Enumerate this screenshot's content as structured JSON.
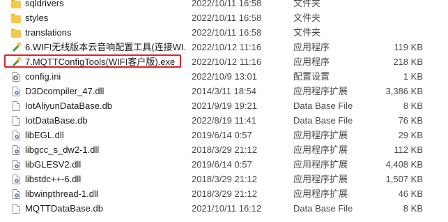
{
  "files": [
    {
      "name": "sqldrivers",
      "date": "2022/10/11 16:58",
      "type": "文件夹",
      "size": "",
      "icon": "folder-icon"
    },
    {
      "name": "styles",
      "date": "2022/10/11 16:58",
      "type": "文件夹",
      "size": "",
      "icon": "folder-icon"
    },
    {
      "name": "translations",
      "date": "2022/10/11 16:58",
      "type": "文件夹",
      "size": "",
      "icon": "folder-icon"
    },
    {
      "name": "6.WIFI无线版本云音响配置工具(连接WI...",
      "date": "2022/10/12 11:16",
      "type": "应用程序",
      "size": "119 KB",
      "icon": "application-icon"
    },
    {
      "name": "7.MQTTConfigTools(WIFI客户版).exe",
      "date": "2022/10/12 11:16",
      "type": "应用程序",
      "size": "218 KB",
      "icon": "application-icon"
    },
    {
      "name": "config.ini",
      "date": "2022/10/9 13:01",
      "type": "配置设置",
      "size": "1 KB",
      "icon": "config-file-icon"
    },
    {
      "name": "D3Dcompiler_47.dll",
      "date": "2014/3/11 18:54",
      "type": "应用程序扩展",
      "size": "3,386 KB",
      "icon": "dll-file-icon"
    },
    {
      "name": "IotAliyunDataBase.db",
      "date": "2021/9/19 19:21",
      "type": "Data Base File",
      "size": "8 KB",
      "icon": "file-icon"
    },
    {
      "name": "IotDataBase.db",
      "date": "2022/8/19 11:41",
      "type": "Data Base File",
      "size": "76 KB",
      "icon": "file-icon"
    },
    {
      "name": "libEGL.dll",
      "date": "2019/6/14 0:57",
      "type": "应用程序扩展",
      "size": "29 KB",
      "icon": "dll-file-icon"
    },
    {
      "name": "libgcc_s_dw2-1.dll",
      "date": "2018/3/29 21:12",
      "type": "应用程序扩展",
      "size": "112 KB",
      "icon": "dll-file-icon"
    },
    {
      "name": "libGLESV2.dll",
      "date": "2019/6/14 0:57",
      "type": "应用程序扩展",
      "size": "4,408 KB",
      "icon": "dll-file-icon"
    },
    {
      "name": "libstdc++-6.dll",
      "date": "2018/3/29 21:12",
      "type": "应用程序扩展",
      "size": "1,507 KB",
      "icon": "dll-file-icon"
    },
    {
      "name": "libwinpthread-1.dll",
      "date": "2018/3/29 21:12",
      "type": "应用程序扩展",
      "size": "46 KB",
      "icon": "dll-file-icon"
    },
    {
      "name": "MQTTDataBase.db",
      "date": "2021/10/11 16:12",
      "type": "Data Base File",
      "size": "8 KB",
      "icon": "file-icon"
    }
  ],
  "highlight_color": "#e0202a"
}
